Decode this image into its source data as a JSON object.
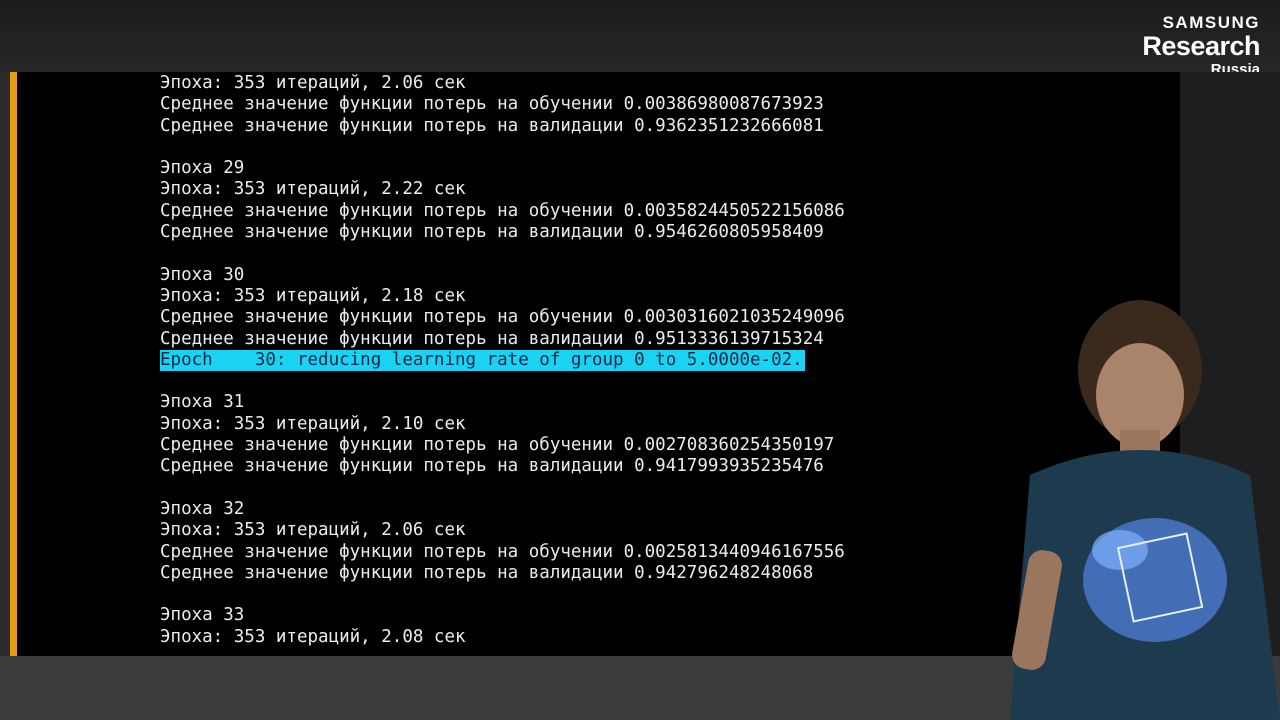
{
  "logo": {
    "line1": "SAMSUNG",
    "line2": "Research",
    "line3": "Russia"
  },
  "output_lines": [
    {
      "text": "Эпоха: 353 итераций, 2.06 сек"
    },
    {
      "text": "Среднее значение функции потерь на обучении 0.00386980087673923"
    },
    {
      "text": "Среднее значение функции потерь на валидации 0.9362351232666081"
    },
    {
      "text": ""
    },
    {
      "text": "Эпоха 29"
    },
    {
      "text": "Эпоха: 353 итераций, 2.22 сек"
    },
    {
      "text": "Среднее значение функции потерь на обучении 0.0035824450522156086"
    },
    {
      "text": "Среднее значение функции потерь на валидации 0.9546260805958409"
    },
    {
      "text": ""
    },
    {
      "text": "Эпоха 30"
    },
    {
      "text": "Эпоха: 353 итераций, 2.18 сек"
    },
    {
      "text": "Среднее значение функции потерь на обучении 0.0030316021035249096"
    },
    {
      "text": "Среднее значение функции потерь на валидации 0.9513336139715324"
    },
    {
      "text": "Epoch    30: reducing learning rate of group 0 to 5.0000e-02.",
      "highlight": true
    },
    {
      "text": ""
    },
    {
      "text": "Эпоха 31"
    },
    {
      "text": "Эпоха: 353 итераций, 2.10 сек"
    },
    {
      "text": "Среднее значение функции потерь на обучении 0.002708360254350197"
    },
    {
      "text": "Среднее значение функции потерь на валидации 0.9417993935235476"
    },
    {
      "text": ""
    },
    {
      "text": "Эпоха 32"
    },
    {
      "text": "Эпоха: 353 итераций, 2.06 сек"
    },
    {
      "text": "Среднее значение функции потерь на обучении 0.0025813440946167556"
    },
    {
      "text": "Среднее значение функции потерь на валидации 0.942796248248068"
    },
    {
      "text": ""
    },
    {
      "text": "Эпоха 33"
    },
    {
      "text": "Эпоха: 353 итераций, 2.08 сек"
    }
  ],
  "colors": {
    "cell_accent": "#e59a13",
    "highlight_bg": "#1ad3f2",
    "output_bg": "#000000",
    "output_text": "#ececec"
  }
}
